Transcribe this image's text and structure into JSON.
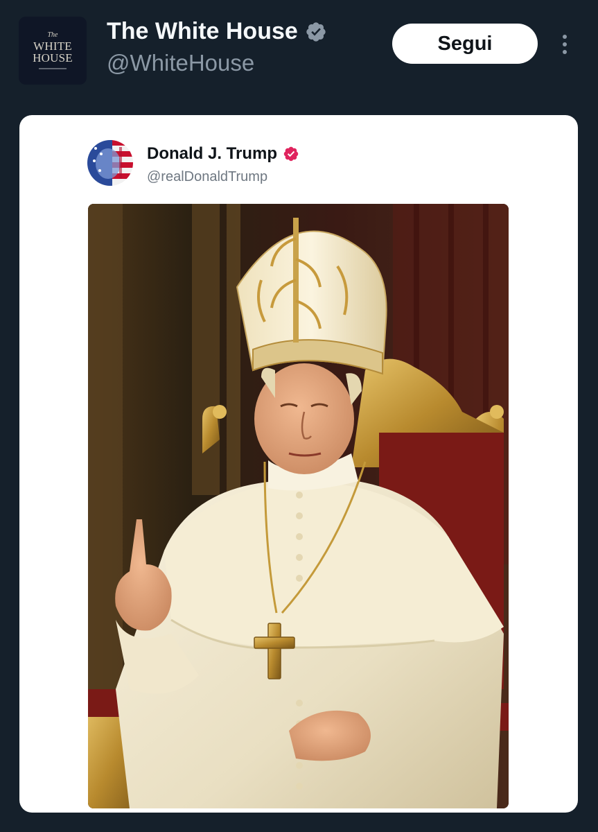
{
  "account": {
    "display_name": "The White House",
    "handle": "@WhiteHouse",
    "avatar": {
      "line1": "The",
      "line2": "WHITE",
      "line3": "HOUSE"
    },
    "verified_icon": "verified-badge-gray",
    "verified_color": "#8b98a5"
  },
  "actions": {
    "follow_label": "Segui",
    "more_icon": "more-vertical-icon"
  },
  "embedded_post": {
    "display_name": "Donald J. Trump",
    "handle": "@realDonaldTrump",
    "verified_icon": "verified-badge-pink",
    "verified_color": "#e0245e",
    "avatar_icon": "flag-portrait-avatar"
  },
  "colors": {
    "background": "#15202b",
    "card": "#ffffff",
    "name_text": "#f5f8fa",
    "handle_text": "#8b98a5"
  }
}
